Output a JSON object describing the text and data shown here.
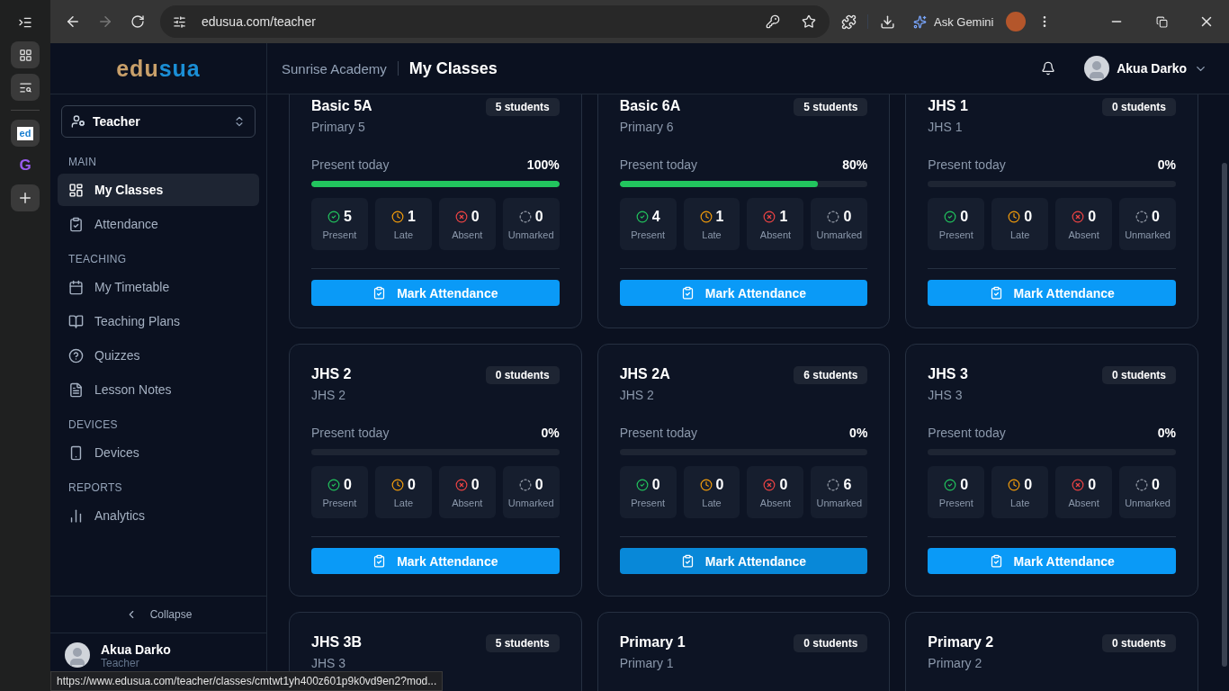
{
  "browser": {
    "url": "edusua.com/teacher",
    "gemini_label": "Ask Gemini",
    "side_tabs": [
      {
        "kind": "favicon",
        "label": "ed"
      },
      {
        "kind": "letter",
        "label": "G"
      }
    ],
    "status_url": "https://www.edusua.com/teacher/classes/cmtwt1yh400z601p9k0vd9en2?mod..."
  },
  "logo": {
    "part_1": "edu",
    "part_2": "sua"
  },
  "header": {
    "school": "Sunrise Academy",
    "title": "My Classes",
    "user": "Akua Darko"
  },
  "sidebar": {
    "role": "Teacher",
    "sections": [
      {
        "title": "MAIN",
        "items": [
          {
            "label": "My Classes",
            "selected": true
          },
          {
            "label": "Attendance",
            "selected": false
          }
        ]
      },
      {
        "title": "TEACHING",
        "items": [
          {
            "label": "My Timetable",
            "selected": false
          },
          {
            "label": "Teaching Plans",
            "selected": false
          },
          {
            "label": "Quizzes",
            "selected": false
          },
          {
            "label": "Lesson Notes",
            "selected": false
          }
        ]
      },
      {
        "title": "DEVICES",
        "items": [
          {
            "label": "Devices",
            "selected": false
          }
        ]
      },
      {
        "title": "REPORTS",
        "items": [
          {
            "label": "Analytics",
            "selected": false
          }
        ]
      }
    ],
    "collapse": "Collapse",
    "user": {
      "name": "Akua Darko",
      "role": "Teacher"
    }
  },
  "classes": [
    {
      "name": "Basic 5A",
      "grade": "Primary 5",
      "students": "5 students",
      "present_label": "Present today",
      "percent": "100%",
      "level": 1,
      "stats": [
        {
          "kind": "present",
          "value": "5",
          "label": "Present"
        },
        {
          "kind": "late",
          "value": "1",
          "label": "Late"
        },
        {
          "kind": "absent",
          "value": "0",
          "label": "Absent"
        },
        {
          "kind": "unmarked",
          "value": "0",
          "label": "Unmarked"
        }
      ],
      "button": "Mark Attendance",
      "hovered": false
    },
    {
      "name": "Basic 6A",
      "grade": "Primary 6",
      "students": "5 students",
      "present_label": "Present today",
      "percent": "80%",
      "level": 0.8,
      "stats": [
        {
          "kind": "present",
          "value": "4",
          "label": "Present"
        },
        {
          "kind": "late",
          "value": "1",
          "label": "Late"
        },
        {
          "kind": "absent",
          "value": "1",
          "label": "Absent"
        },
        {
          "kind": "unmarked",
          "value": "0",
          "label": "Unmarked"
        }
      ],
      "button": "Mark Attendance",
      "hovered": false
    },
    {
      "name": "JHS 1",
      "grade": "JHS 1",
      "students": "0 students",
      "present_label": "Present today",
      "percent": "0%",
      "level": 0,
      "stats": [
        {
          "kind": "present",
          "value": "0",
          "label": "Present"
        },
        {
          "kind": "late",
          "value": "0",
          "label": "Late"
        },
        {
          "kind": "absent",
          "value": "0",
          "label": "Absent"
        },
        {
          "kind": "unmarked",
          "value": "0",
          "label": "Unmarked"
        }
      ],
      "button": "Mark Attendance",
      "hovered": false
    },
    {
      "name": "JHS 2",
      "grade": "JHS 2",
      "students": "0 students",
      "present_label": "Present today",
      "percent": "0%",
      "level": 0,
      "stats": [
        {
          "kind": "present",
          "value": "0",
          "label": "Present"
        },
        {
          "kind": "late",
          "value": "0",
          "label": "Late"
        },
        {
          "kind": "absent",
          "value": "0",
          "label": "Absent"
        },
        {
          "kind": "unmarked",
          "value": "0",
          "label": "Unmarked"
        }
      ],
      "button": "Mark Attendance",
      "hovered": false
    },
    {
      "name": "JHS 2A",
      "grade": "JHS 2",
      "students": "6 students",
      "present_label": "Present today",
      "percent": "0%",
      "level": 0,
      "stats": [
        {
          "kind": "present",
          "value": "0",
          "label": "Present"
        },
        {
          "kind": "late",
          "value": "0",
          "label": "Late"
        },
        {
          "kind": "absent",
          "value": "0",
          "label": "Absent"
        },
        {
          "kind": "unmarked",
          "value": "6",
          "label": "Unmarked"
        }
      ],
      "button": "Mark Attendance",
      "hovered": true
    },
    {
      "name": "JHS 3",
      "grade": "JHS 3",
      "students": "0 students",
      "present_label": "Present today",
      "percent": "0%",
      "level": 0,
      "stats": [
        {
          "kind": "present",
          "value": "0",
          "label": "Present"
        },
        {
          "kind": "late",
          "value": "0",
          "label": "Late"
        },
        {
          "kind": "absent",
          "value": "0",
          "label": "Absent"
        },
        {
          "kind": "unmarked",
          "value": "0",
          "label": "Unmarked"
        }
      ],
      "button": "Mark Attendance",
      "hovered": false
    },
    {
      "name": "JHS 3B",
      "grade": "JHS 3",
      "students": "5 students"
    },
    {
      "name": "Primary 1",
      "grade": "Primary 1",
      "students": "0 students"
    },
    {
      "name": "Primary 2",
      "grade": "Primary 2",
      "students": "0 students"
    }
  ]
}
